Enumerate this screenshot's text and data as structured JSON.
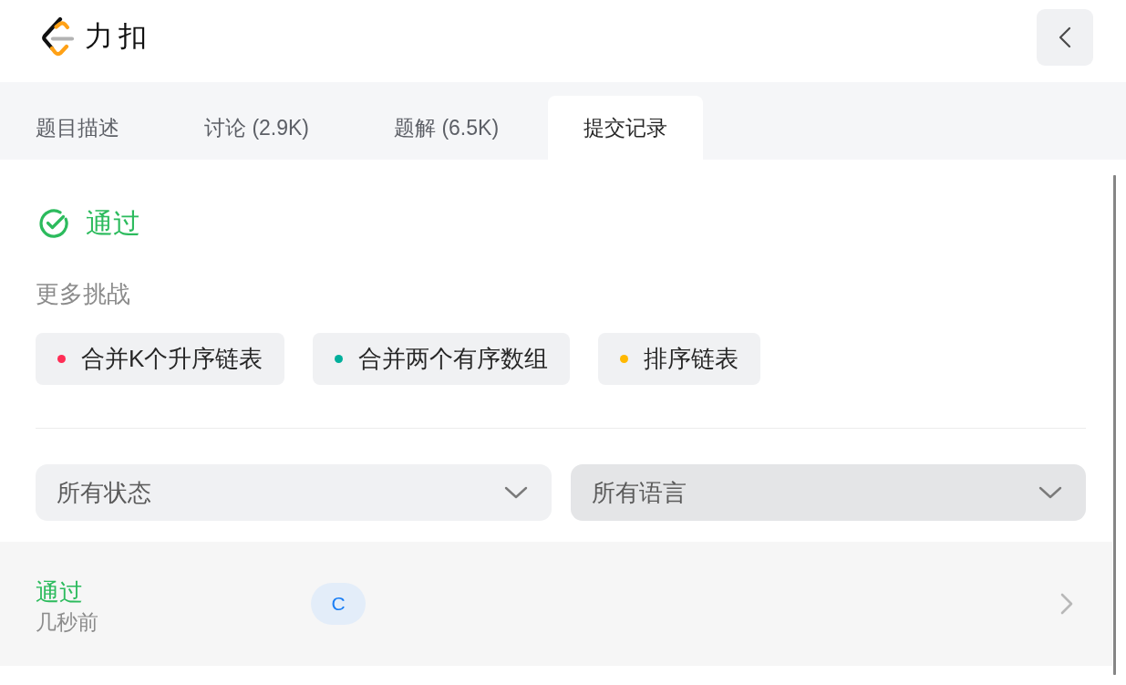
{
  "header": {
    "logo_text": "力扣"
  },
  "tabs": [
    {
      "label": "题目描述",
      "selected": false
    },
    {
      "label": "讨论 (2.9K)",
      "selected": false
    },
    {
      "label": "题解 (6.5K)",
      "selected": false
    },
    {
      "label": "提交记录",
      "selected": true
    }
  ],
  "result": {
    "kind": "accepted",
    "status": "通过"
  },
  "more_challenges": {
    "title": "更多挑战",
    "problems": [
      {
        "title": "合并K个升序链表",
        "color": "#ff2d55"
      },
      {
        "title": "合并两个有序数组",
        "color": "#00af9b"
      },
      {
        "title": "排序链表",
        "color": "#ffb800"
      }
    ]
  },
  "filters": [
    {
      "label": "所有状态",
      "hovered": false
    },
    {
      "label": "所有语言",
      "hovered": true
    }
  ],
  "submissions": [
    {
      "kind": "accepted",
      "status": "通过",
      "time": "几秒前",
      "language": "C"
    }
  ]
}
